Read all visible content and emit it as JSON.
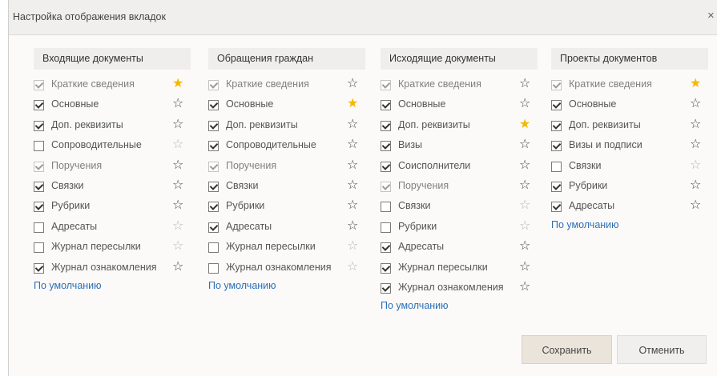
{
  "dialog": {
    "title": "Настройка отображения вкладок",
    "close_symbol": "×"
  },
  "columns": [
    {
      "header": "Входящие документы",
      "default_link": "По умолчанию",
      "items": [
        {
          "label": "Краткие сведения",
          "checked": true,
          "disabled": true,
          "star": "on"
        },
        {
          "label": "Основные",
          "checked": true,
          "disabled": false,
          "star": "off"
        },
        {
          "label": "Доп. реквизиты",
          "checked": true,
          "disabled": false,
          "star": "off"
        },
        {
          "label": "Сопроводительные",
          "checked": false,
          "disabled": false,
          "star": "muted"
        },
        {
          "label": "Поручения",
          "checked": true,
          "disabled": true,
          "star": "off"
        },
        {
          "label": "Связки",
          "checked": true,
          "disabled": false,
          "star": "off"
        },
        {
          "label": "Рубрики",
          "checked": true,
          "disabled": false,
          "star": "off"
        },
        {
          "label": "Адресаты",
          "checked": false,
          "disabled": false,
          "star": "muted"
        },
        {
          "label": "Журнал пересылки",
          "checked": false,
          "disabled": false,
          "star": "muted"
        },
        {
          "label": "Журнал ознакомления",
          "checked": true,
          "disabled": false,
          "star": "off"
        }
      ]
    },
    {
      "header": "Обращения граждан",
      "default_link": "По умолчанию",
      "items": [
        {
          "label": "Краткие сведения",
          "checked": true,
          "disabled": true,
          "star": "off"
        },
        {
          "label": "Основные",
          "checked": true,
          "disabled": false,
          "star": "on"
        },
        {
          "label": "Доп. реквизиты",
          "checked": true,
          "disabled": false,
          "star": "off"
        },
        {
          "label": "Сопроводительные",
          "checked": true,
          "disabled": false,
          "star": "off"
        },
        {
          "label": "Поручения",
          "checked": true,
          "disabled": true,
          "star": "off"
        },
        {
          "label": "Связки",
          "checked": true,
          "disabled": false,
          "star": "off"
        },
        {
          "label": "Рубрики",
          "checked": true,
          "disabled": false,
          "star": "off"
        },
        {
          "label": "Адресаты",
          "checked": true,
          "disabled": false,
          "star": "off"
        },
        {
          "label": "Журнал пересылки",
          "checked": false,
          "disabled": false,
          "star": "muted"
        },
        {
          "label": "Журнал ознакомления",
          "checked": false,
          "disabled": false,
          "star": "muted"
        }
      ]
    },
    {
      "header": "Исходящие документы",
      "default_link": "По умолчанию",
      "items": [
        {
          "label": "Краткие сведения",
          "checked": true,
          "disabled": true,
          "star": "off"
        },
        {
          "label": "Основные",
          "checked": true,
          "disabled": false,
          "star": "off"
        },
        {
          "label": "Доп. реквизиты",
          "checked": true,
          "disabled": false,
          "star": "on"
        },
        {
          "label": "Визы",
          "checked": true,
          "disabled": false,
          "star": "off"
        },
        {
          "label": "Соисполнители",
          "checked": true,
          "disabled": false,
          "star": "off"
        },
        {
          "label": "Поручения",
          "checked": true,
          "disabled": true,
          "star": "off"
        },
        {
          "label": "Связки",
          "checked": false,
          "disabled": false,
          "star": "muted"
        },
        {
          "label": "Рубрики",
          "checked": false,
          "disabled": false,
          "star": "muted"
        },
        {
          "label": "Адресаты",
          "checked": true,
          "disabled": false,
          "star": "off"
        },
        {
          "label": "Журнал пересылки",
          "checked": true,
          "disabled": false,
          "star": "off"
        },
        {
          "label": "Журнал ознакомления",
          "checked": true,
          "disabled": false,
          "star": "off"
        }
      ]
    },
    {
      "header": "Проекты документов",
      "default_link": "По умолчанию",
      "items": [
        {
          "label": "Краткие сведения",
          "checked": true,
          "disabled": true,
          "star": "on"
        },
        {
          "label": "Основные",
          "checked": true,
          "disabled": false,
          "star": "off"
        },
        {
          "label": "Доп. реквизиты",
          "checked": true,
          "disabled": false,
          "star": "off"
        },
        {
          "label": "Визы и подписи",
          "checked": true,
          "disabled": false,
          "star": "off"
        },
        {
          "label": "Связки",
          "checked": false,
          "disabled": false,
          "star": "muted"
        },
        {
          "label": "Рубрики",
          "checked": true,
          "disabled": false,
          "star": "off"
        },
        {
          "label": "Адресаты",
          "checked": true,
          "disabled": false,
          "star": "off"
        }
      ]
    }
  ],
  "buttons": {
    "save": "Сохранить",
    "cancel": "Отменить"
  },
  "colors": {
    "star_active": "#f5b800",
    "link": "#2b6fb6",
    "save_button_bg": "#ebe4db"
  },
  "icons": {
    "star": "star-icon",
    "checkbox": "checkbox-icon",
    "close": "close-icon"
  }
}
